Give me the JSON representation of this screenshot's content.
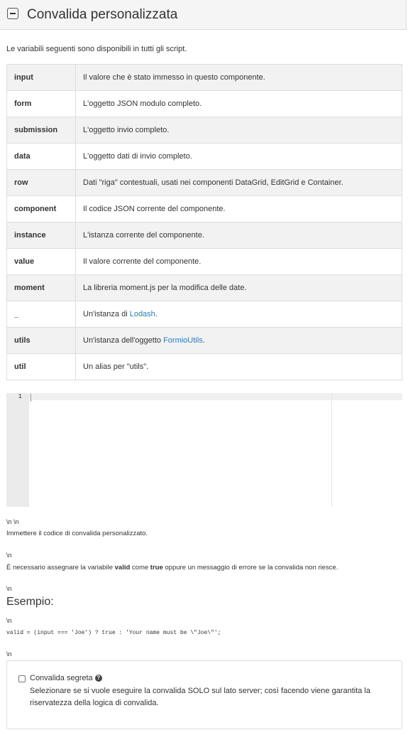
{
  "panel": {
    "title": "Convalida personalizzata",
    "collapse_icon": "minus-square-icon"
  },
  "intro": "Le variabili seguenti sono disponibili in tutti gli script.",
  "variables": [
    {
      "name": "input",
      "desc": "Il valore che è stato immesso in questo componente."
    },
    {
      "name": "form",
      "desc": "L'oggetto JSON modulo completo."
    },
    {
      "name": "submission",
      "desc": "L'oggetto invio completo."
    },
    {
      "name": "data",
      "desc": "L'oggetto dati di invio completo."
    },
    {
      "name": "row",
      "desc": "Dati \"riga\" contestuali, usati nei componenti DataGrid, EditGrid e Container."
    },
    {
      "name": "component",
      "desc": "Il codice JSON corrente del componente."
    },
    {
      "name": "instance",
      "desc": "L'istanza corrente del componente."
    },
    {
      "name": "value",
      "desc": "Il valore corrente del componente."
    },
    {
      "name": "moment",
      "desc": "La libreria moment.js per la modifica delle date."
    },
    {
      "name": "_",
      "desc_pre": "Un'istanza di ",
      "link": "Lodash",
      "desc_post": "."
    },
    {
      "name": "utils",
      "desc_pre": "Un'istanza dell'oggetto ",
      "link": "FormioUtils",
      "desc_post": "."
    },
    {
      "name": "util",
      "desc": "Un alias per \"utils\"."
    }
  ],
  "editor": {
    "line_number": "1"
  },
  "help": {
    "esc1": "\\n \\n",
    "line1": "Immettere il codice di convalida personalizzato.",
    "esc2": "\\n",
    "line2_pre": "È necessario assegnare la variabile ",
    "line2_b1": "valid",
    "line2_mid": " come ",
    "line2_b2": "true",
    "line2_post": " oppure un messaggio di errore se la convalida non riesce.",
    "esc3": "\\n",
    "example_heading": "Esempio:",
    "esc4": "\\n",
    "example_code": "valid = (input === 'Joe') ? true : 'Your name must be \\\"Joe\\\"';",
    "esc5": "\\n"
  },
  "secret": {
    "label": "Convalida segreta",
    "help_icon": "question-circle-icon",
    "description": "Selezionare se si vuole eseguire la convalida SOLO sul lato server; così facendo viene garantita la riservatezza della logica di convalida.",
    "checked": false
  }
}
